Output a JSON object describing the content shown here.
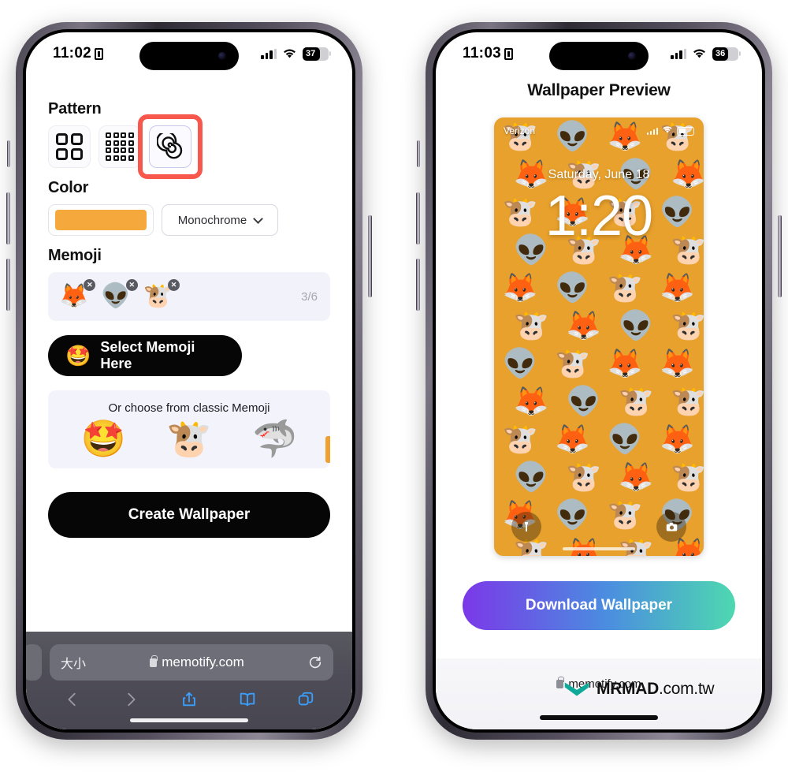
{
  "left_phone": {
    "status_bar": {
      "time": "11:02",
      "battery_percent": "37",
      "icons": [
        "cellular-bars-icon",
        "wifi-icon",
        "battery-icon",
        "lock-portrait-icon"
      ]
    },
    "sections": {
      "pattern": {
        "title": "Pattern",
        "options": [
          {
            "name": "grid-2x2",
            "selected": false
          },
          {
            "name": "grid-4x4",
            "selected": false
          },
          {
            "name": "spiral",
            "selected": true
          }
        ]
      },
      "color": {
        "title": "Color",
        "swatch_hex": "#F5A93C",
        "mode_selected": "Monochrome"
      },
      "memoji": {
        "title": "Memoji",
        "selected": [
          {
            "glyph": "🦊",
            "name": "fox-memoji"
          },
          {
            "glyph": "👽",
            "name": "alien-memoji"
          },
          {
            "glyph": "🐮",
            "name": "cow-memoji"
          }
        ],
        "counter": "3/6",
        "select_button_label": "Select Memoji Here",
        "select_button_face": "🤩",
        "classic_title": "Or choose from classic Memoji",
        "classic_items": [
          {
            "glyph": "🤩",
            "name": "star-struck-octopus-memoji"
          },
          {
            "glyph": "🐮",
            "name": "cow-classic-memoji"
          },
          {
            "glyph": "🦈",
            "name": "shark-classic-memoji"
          }
        ]
      }
    },
    "create_button_label": "Create Wallpaper",
    "safari": {
      "aa_label": "大小",
      "url": "memotify.com",
      "toolbar_icons": [
        "back-icon",
        "forward-icon",
        "share-icon",
        "bookmarks-icon",
        "tabs-icon"
      ]
    }
  },
  "right_phone": {
    "status_bar": {
      "time": "11:03",
      "battery_percent": "36"
    },
    "page_title": "Wallpaper Preview",
    "wallpaper": {
      "background_hex": "#E8A12C",
      "carrier": "Verizon",
      "date": "Saturday, June 18",
      "time": "1:20",
      "bottom_left_icon": "flashlight-icon",
      "bottom_right_icon": "camera-icon",
      "emojis": [
        "🐮",
        "👽",
        "🦊",
        "🐮",
        "🦊",
        "🐮",
        "👽",
        "🦊",
        "🐮",
        "🦊",
        "🐮",
        "👽",
        "👽",
        "🐮",
        "🦊",
        "🐮",
        "🦊",
        "👽",
        "🐮",
        "🦊",
        "🐮",
        "🦊",
        "👽",
        "🐮",
        "👽",
        "🐮",
        "🦊",
        "🦊",
        "🦊",
        "👽",
        "🐮",
        "🐮",
        "🐮",
        "🦊",
        "👽",
        "🦊",
        "👽",
        "🐮",
        "🦊",
        "🐮",
        "🦊",
        "👽",
        "🐮",
        "👽",
        "🐮",
        "🦊",
        "🐮",
        "🦊",
        "👽",
        "🦊",
        "🐮",
        "👽",
        "🐮",
        "🦊",
        "👽",
        "🐮"
      ]
    },
    "download_button_label": "Download Wallpaper",
    "download_gradient": {
      "from": "#7B38E8",
      "mid": "#4B8CE0",
      "to": "#4ED8B0"
    },
    "bottom_bar": {
      "url": "memotify.com"
    }
  },
  "watermark": {
    "brand": "MRMAD",
    "tld": ".com.tw",
    "logo_hex": "#0FA99A"
  }
}
